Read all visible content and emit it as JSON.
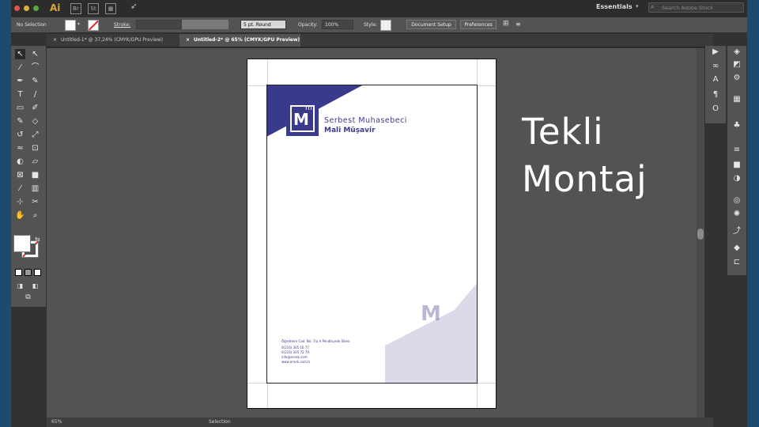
{
  "app": {
    "logo": "Ai",
    "workspace": "Essentials",
    "search_placeholder": "Search Adobe Stock"
  },
  "control_bar": {
    "selection": "No Selection",
    "stroke_label": "Stroke:",
    "brush_value": "5 pt. Round",
    "opacity_label": "Opacity:",
    "opacity_value": "100%",
    "style_label": "Style:",
    "doc_setup": "Document Setup",
    "preferences": "Preferences"
  },
  "tabs": [
    {
      "label": "Untitled-1* @ 37,24% (CMYK/GPU Preview)",
      "active": false
    },
    {
      "label": "Untitled-2* @ 65% (CMYK/GPU Preview)",
      "active": true
    }
  ],
  "status": {
    "zoom": "65%",
    "tool": "Selection"
  },
  "document": {
    "company_line1": "Serbest Muhasebeci",
    "company_line2": "Mali Müşavir",
    "contact_title": "Öğretmen Cad. No: 7/a A Pendikçede Sitesi",
    "contact_lines": [
      "0(216) 305 16 77",
      "0(216) 305 72 79",
      "info@ornek.com",
      "www.ornek.com.tr"
    ],
    "logo_letter": "m",
    "brand_color": "#3a3a8c"
  },
  "overlay": {
    "line1": "Tekli",
    "line2": "Montaj"
  },
  "colors": {
    "frame": "#1d4b6e",
    "ui_dark": "#323232",
    "ui_panel": "#535353"
  }
}
